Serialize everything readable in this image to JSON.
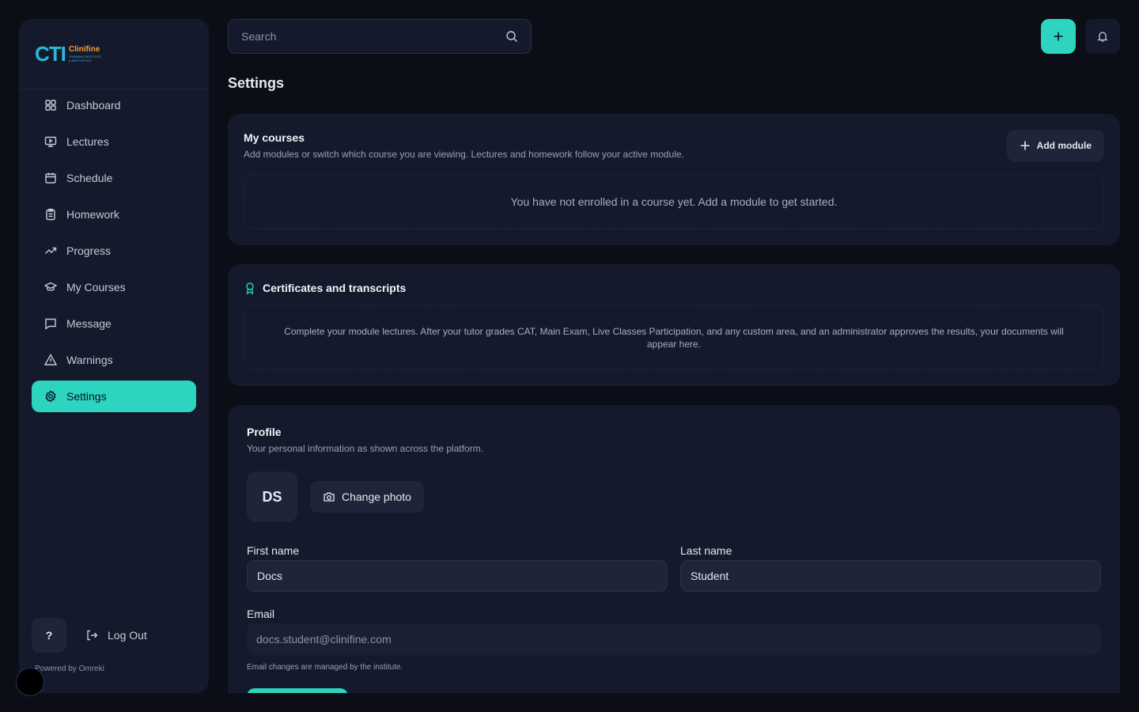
{
  "app": {
    "logo_mark": "CTI",
    "logo_line1": "Clinifine",
    "logo_line2": "TRAINING INSTITUTE",
    "logo_line3": "& AESTHETICS",
    "powered_by": "Powered by Omreki"
  },
  "sidebar": {
    "items": [
      {
        "label": "Dashboard",
        "icon": "grid-icon"
      },
      {
        "label": "Lectures",
        "icon": "monitor-icon"
      },
      {
        "label": "Schedule",
        "icon": "calendar-icon"
      },
      {
        "label": "Homework",
        "icon": "clipboard-icon"
      },
      {
        "label": "Progress",
        "icon": "trending-up-icon"
      },
      {
        "label": "My Courses",
        "icon": "graduation-cap-icon"
      },
      {
        "label": "Message",
        "icon": "message-icon"
      },
      {
        "label": "Warnings",
        "icon": "warning-icon"
      },
      {
        "label": "Settings",
        "icon": "gear-icon",
        "active": true
      }
    ],
    "help_label": "?",
    "logout_label": "Log Out"
  },
  "topbar": {
    "search_placeholder": "Search"
  },
  "page": {
    "title": "Settings"
  },
  "courses": {
    "title": "My courses",
    "subtitle": "Add modules or switch which course you are viewing. Lectures and homework follow your active module.",
    "add_label": "Add module",
    "empty": "You have not enrolled in a course yet. Add a module to get started."
  },
  "certificates": {
    "title": "Certificates and transcripts",
    "empty": "Complete your module lectures. After your tutor grades CAT, Main Exam, Live Classes Participation, and any custom area, and an administrator approves the results, your documents will appear here."
  },
  "profile": {
    "title": "Profile",
    "subtitle": "Your personal information as shown across the platform.",
    "initials": "DS",
    "change_photo": "Change photo",
    "first_name_label": "First name",
    "first_name": "Docs",
    "last_name_label": "Last name",
    "last_name": "Student",
    "email_label": "Email",
    "email": "docs.student@clinifine.com",
    "email_note": "Email changes are managed by the institute."
  },
  "colors": {
    "accent": "#2dd4bf",
    "background": "#0b0e17",
    "panel": "#141a2b"
  }
}
